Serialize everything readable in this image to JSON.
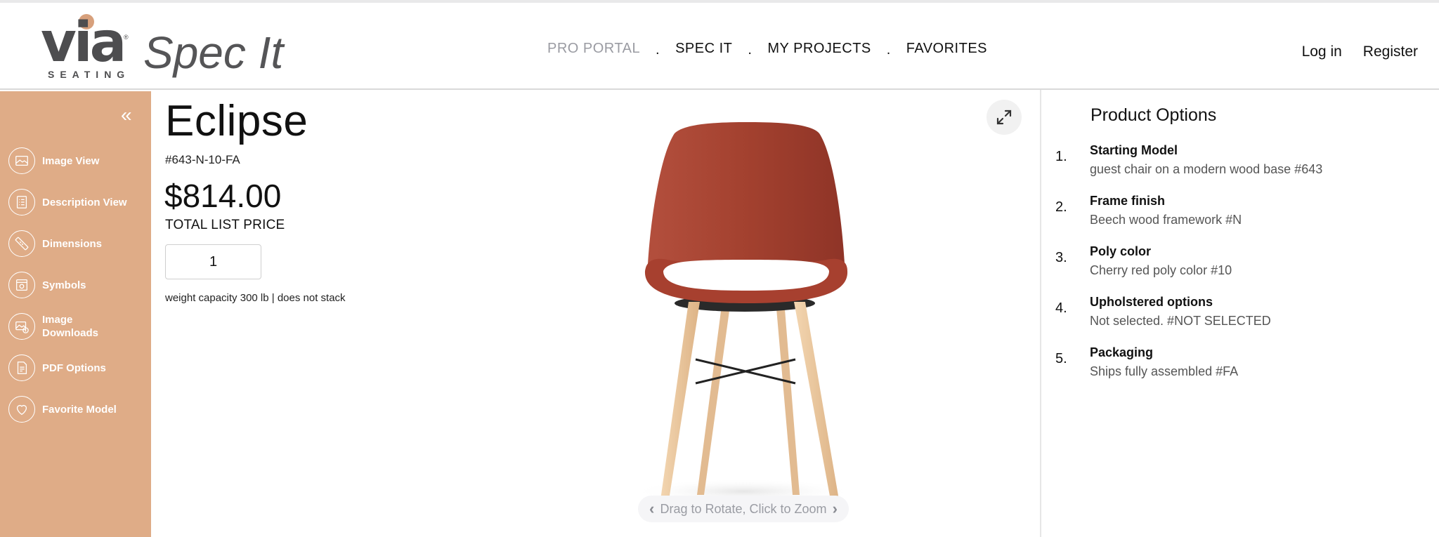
{
  "brand": {
    "logo_text": "via",
    "logo_sub": "SEATING",
    "app_name": "Spec It",
    "accent": "#dfac87"
  },
  "nav": {
    "items": [
      {
        "label": "PRO PORTAL",
        "active": true
      },
      {
        "label": "SPEC IT",
        "active": false
      },
      {
        "label": "MY PROJECTS",
        "active": false
      },
      {
        "label": "FAVORITES",
        "active": false
      }
    ],
    "separator": "."
  },
  "auth": {
    "login": "Log in",
    "register": "Register"
  },
  "sidebar": {
    "collapse_icon": "double-chevron-left",
    "collapse_glyph": "«",
    "items": [
      {
        "label": "Image View",
        "icon": "image-icon"
      },
      {
        "label": "Description View",
        "icon": "checklist-icon"
      },
      {
        "label": "Dimensions",
        "icon": "ruler-icon"
      },
      {
        "label": "Symbols",
        "icon": "symbol-icon"
      },
      {
        "label": "Image Downloads",
        "icon": "image-download-icon"
      },
      {
        "label": "PDF Options",
        "icon": "pdf-icon"
      },
      {
        "label": "Favorite Model",
        "icon": "heart-icon"
      }
    ]
  },
  "product": {
    "name": "Eclipse",
    "sku": "#643-N-10-FA",
    "price": "$814.00",
    "price_label": "TOTAL LIST PRICE",
    "quantity": "1",
    "note": "weight capacity 300 lb | does not stack"
  },
  "viewer": {
    "expand_icon": "expand-icon",
    "hint": "Drag to Rotate, Click to Zoom",
    "hint_left": "‹",
    "hint_right": "›"
  },
  "options": {
    "title": "Product Options",
    "items": [
      {
        "num": "1.",
        "label": "Starting Model",
        "value": "guest chair on a modern wood base #643"
      },
      {
        "num": "2.",
        "label": "Frame finish",
        "value": "Beech wood framework #N"
      },
      {
        "num": "3.",
        "label": "Poly color",
        "value": "Cherry red poly color #10"
      },
      {
        "num": "4.",
        "label": "Upholstered options",
        "value": "Not selected. #NOT SELECTED"
      },
      {
        "num": "5.",
        "label": "Packaging",
        "value": "Ships fully assembled #FA"
      }
    ]
  }
}
